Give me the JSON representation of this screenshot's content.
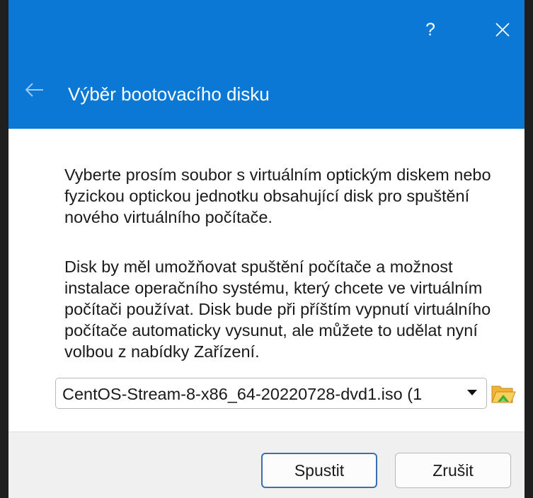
{
  "header": {
    "help_label": "?",
    "title": "Výběr bootovacího disku"
  },
  "content": {
    "paragraph1": "Vyberte prosím soubor s virtuálním optickým diskem nebo fyzickou optickou jednotku obsahující disk pro spuštění nového virtuálního počítače.",
    "paragraph2": "Disk by měl umožňovat spuštění počítače a možnost instalace operačního systému, který chcete ve virtuálním počítači používat. Disk bude při příštím vypnutí virtuálního počítače automaticky vysunut, ale můžete to udělat nyní volbou z nabídky Zařízení."
  },
  "disk_select": {
    "selected_value": "CentOS-Stream-8-x86_64-20220728-dvd1.iso (1"
  },
  "buttons": {
    "start_label": "Spustit",
    "cancel_label": "Zrušit"
  },
  "colors": {
    "header_bg": "#0a78d4",
    "primary_border": "#3a6fb0"
  },
  "icons": {
    "back": "arrow-left-icon",
    "close": "close-icon",
    "folder": "folder-open-icon",
    "dropdown": "chevron-down-icon"
  }
}
